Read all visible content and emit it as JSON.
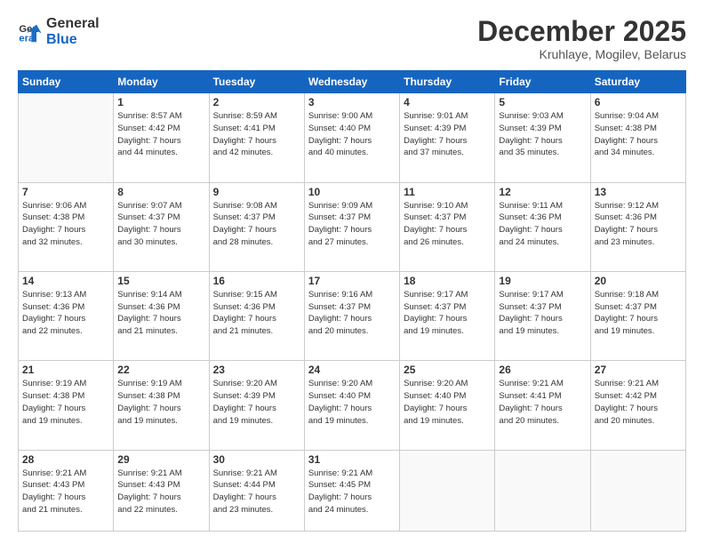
{
  "logo": {
    "line1": "General",
    "line2": "Blue"
  },
  "header": {
    "month": "December 2025",
    "location": "Kruhlaye, Mogilev, Belarus"
  },
  "weekdays": [
    "Sunday",
    "Monday",
    "Tuesday",
    "Wednesday",
    "Thursday",
    "Friday",
    "Saturday"
  ],
  "weeks": [
    [
      {
        "day": "",
        "info": ""
      },
      {
        "day": "1",
        "info": "Sunrise: 8:57 AM\nSunset: 4:42 PM\nDaylight: 7 hours\nand 44 minutes."
      },
      {
        "day": "2",
        "info": "Sunrise: 8:59 AM\nSunset: 4:41 PM\nDaylight: 7 hours\nand 42 minutes."
      },
      {
        "day": "3",
        "info": "Sunrise: 9:00 AM\nSunset: 4:40 PM\nDaylight: 7 hours\nand 40 minutes."
      },
      {
        "day": "4",
        "info": "Sunrise: 9:01 AM\nSunset: 4:39 PM\nDaylight: 7 hours\nand 37 minutes."
      },
      {
        "day": "5",
        "info": "Sunrise: 9:03 AM\nSunset: 4:39 PM\nDaylight: 7 hours\nand 35 minutes."
      },
      {
        "day": "6",
        "info": "Sunrise: 9:04 AM\nSunset: 4:38 PM\nDaylight: 7 hours\nand 34 minutes."
      }
    ],
    [
      {
        "day": "7",
        "info": "Sunrise: 9:06 AM\nSunset: 4:38 PM\nDaylight: 7 hours\nand 32 minutes."
      },
      {
        "day": "8",
        "info": "Sunrise: 9:07 AM\nSunset: 4:37 PM\nDaylight: 7 hours\nand 30 minutes."
      },
      {
        "day": "9",
        "info": "Sunrise: 9:08 AM\nSunset: 4:37 PM\nDaylight: 7 hours\nand 28 minutes."
      },
      {
        "day": "10",
        "info": "Sunrise: 9:09 AM\nSunset: 4:37 PM\nDaylight: 7 hours\nand 27 minutes."
      },
      {
        "day": "11",
        "info": "Sunrise: 9:10 AM\nSunset: 4:37 PM\nDaylight: 7 hours\nand 26 minutes."
      },
      {
        "day": "12",
        "info": "Sunrise: 9:11 AM\nSunset: 4:36 PM\nDaylight: 7 hours\nand 24 minutes."
      },
      {
        "day": "13",
        "info": "Sunrise: 9:12 AM\nSunset: 4:36 PM\nDaylight: 7 hours\nand 23 minutes."
      }
    ],
    [
      {
        "day": "14",
        "info": "Sunrise: 9:13 AM\nSunset: 4:36 PM\nDaylight: 7 hours\nand 22 minutes."
      },
      {
        "day": "15",
        "info": "Sunrise: 9:14 AM\nSunset: 4:36 PM\nDaylight: 7 hours\nand 21 minutes."
      },
      {
        "day": "16",
        "info": "Sunrise: 9:15 AM\nSunset: 4:36 PM\nDaylight: 7 hours\nand 21 minutes."
      },
      {
        "day": "17",
        "info": "Sunrise: 9:16 AM\nSunset: 4:37 PM\nDaylight: 7 hours\nand 20 minutes."
      },
      {
        "day": "18",
        "info": "Sunrise: 9:17 AM\nSunset: 4:37 PM\nDaylight: 7 hours\nand 19 minutes."
      },
      {
        "day": "19",
        "info": "Sunrise: 9:17 AM\nSunset: 4:37 PM\nDaylight: 7 hours\nand 19 minutes."
      },
      {
        "day": "20",
        "info": "Sunrise: 9:18 AM\nSunset: 4:37 PM\nDaylight: 7 hours\nand 19 minutes."
      }
    ],
    [
      {
        "day": "21",
        "info": "Sunrise: 9:19 AM\nSunset: 4:38 PM\nDaylight: 7 hours\nand 19 minutes."
      },
      {
        "day": "22",
        "info": "Sunrise: 9:19 AM\nSunset: 4:38 PM\nDaylight: 7 hours\nand 19 minutes."
      },
      {
        "day": "23",
        "info": "Sunrise: 9:20 AM\nSunset: 4:39 PM\nDaylight: 7 hours\nand 19 minutes."
      },
      {
        "day": "24",
        "info": "Sunrise: 9:20 AM\nSunset: 4:40 PM\nDaylight: 7 hours\nand 19 minutes."
      },
      {
        "day": "25",
        "info": "Sunrise: 9:20 AM\nSunset: 4:40 PM\nDaylight: 7 hours\nand 19 minutes."
      },
      {
        "day": "26",
        "info": "Sunrise: 9:21 AM\nSunset: 4:41 PM\nDaylight: 7 hours\nand 20 minutes."
      },
      {
        "day": "27",
        "info": "Sunrise: 9:21 AM\nSunset: 4:42 PM\nDaylight: 7 hours\nand 20 minutes."
      }
    ],
    [
      {
        "day": "28",
        "info": "Sunrise: 9:21 AM\nSunset: 4:43 PM\nDaylight: 7 hours\nand 21 minutes."
      },
      {
        "day": "29",
        "info": "Sunrise: 9:21 AM\nSunset: 4:43 PM\nDaylight: 7 hours\nand 22 minutes."
      },
      {
        "day": "30",
        "info": "Sunrise: 9:21 AM\nSunset: 4:44 PM\nDaylight: 7 hours\nand 23 minutes."
      },
      {
        "day": "31",
        "info": "Sunrise: 9:21 AM\nSunset: 4:45 PM\nDaylight: 7 hours\nand 24 minutes."
      },
      {
        "day": "",
        "info": ""
      },
      {
        "day": "",
        "info": ""
      },
      {
        "day": "",
        "info": ""
      }
    ]
  ]
}
